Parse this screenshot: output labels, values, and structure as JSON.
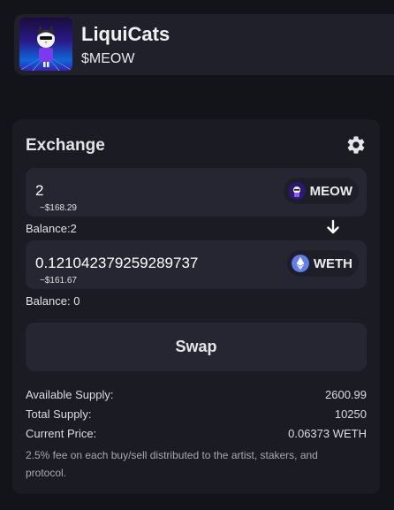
{
  "token": {
    "name": "LiquiCats",
    "symbol": "$MEOW"
  },
  "exchange": {
    "title": "Exchange",
    "from": {
      "amount": "2",
      "usd": "~$168.29",
      "token_label": "MEOW",
      "balance": "Balance:2"
    },
    "to": {
      "amount": "0.12104237925928973​7",
      "usd": "~$161.67",
      "token_label": "WETH",
      "balance": "Balance: 0"
    },
    "swap_label": "Swap"
  },
  "stats": {
    "available_supply_label": "Available Supply:",
    "available_supply_value": "2600.99",
    "total_supply_label": "Total Supply:",
    "total_supply_value": "10250",
    "current_price_label": "Current Price:",
    "current_price_value": "0.06373 WETH",
    "fee_note": "2.5% fee on each buy/sell distributed to the artist, stakers, and protocol."
  },
  "icons": {
    "settings": "gear-icon",
    "direction": "arrow-down-icon",
    "meow": "meow-token-icon",
    "weth": "weth-token-icon"
  },
  "colors": {
    "background": "#13131a",
    "panel": "#1a1b23",
    "input": "#252631",
    "weth_blue": "#627eea"
  }
}
